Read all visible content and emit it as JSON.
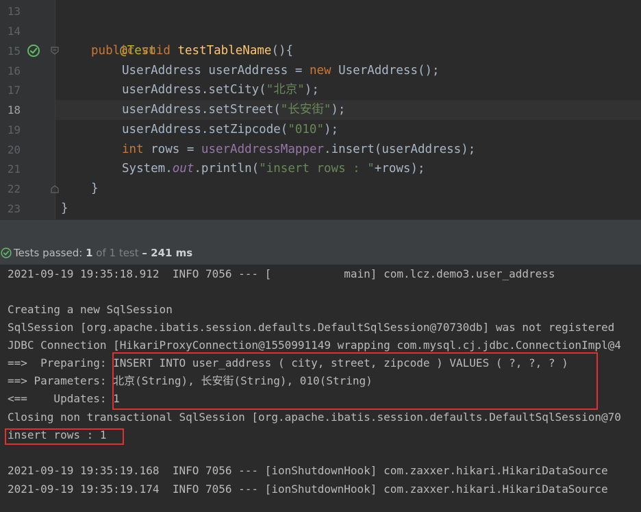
{
  "editor": {
    "line_numbers": [
      "13",
      "14",
      "15",
      "16",
      "17",
      "18",
      "19",
      "20",
      "21",
      "22",
      "23"
    ],
    "active_line": "18",
    "code": {
      "l14": {
        "annotation": "@Test"
      },
      "l15": {
        "kw1": "public",
        "kw2": "void",
        "method": "testTableName",
        "rest": "(){"
      },
      "l16": {
        "p1": "UserAddress userAddress = ",
        "kw": "new",
        "p2": " UserAddress();"
      },
      "l17": {
        "p1": "userAddress.setCity(",
        "str": "\"北京\"",
        "p2": ");"
      },
      "l18": {
        "p1": "userAddress.setStreet(",
        "str": "\"长安街\"",
        "p2": ");"
      },
      "l19": {
        "p1": "userAddress.setZipcode(",
        "str": "\"010\"",
        "p2": ");"
      },
      "l20": {
        "kw": "int",
        "p1": " rows = ",
        "field": "userAddressMapper",
        "p2": ".insert(userAddress);"
      },
      "l21": {
        "p1": "System.",
        "field": "out",
        "p2": ".println(",
        "str": "\"insert rows : \"",
        "p3": "+rows);"
      },
      "l22": {
        "brace": "}"
      },
      "l23": {
        "brace": "}"
      }
    }
  },
  "status": {
    "prefix": "Tests passed:",
    "count": "1",
    "of_text": "of 1 test",
    "time": "– 241 ms"
  },
  "console": {
    "lines": [
      "2021-09-19 19:35:18.912  INFO 7056 --- [           main] com.lcz.demo3.user_address",
      "",
      "Creating a new SqlSession",
      "SqlSession [org.apache.ibatis.session.defaults.DefaultSqlSession@70730db] was not registered",
      "JDBC Connection [HikariProxyConnection@1550991149 wrapping com.mysql.cj.jdbc.ConnectionImpl@4",
      "==>  Preparing: INSERT INTO user_address ( city, street, zipcode ) VALUES ( ?, ?, ? )",
      "==> Parameters: 北京(String), 长安街(String), 010(String)",
      "<==    Updates: 1",
      "Closing non transactional SqlSession [org.apache.ibatis.session.defaults.DefaultSqlSession@70",
      "insert rows : 1",
      "",
      "2021-09-19 19:35:19.168  INFO 7056 --- [ionShutdownHook] com.zaxxer.hikari.HikariDataSource",
      "2021-09-19 19:35:19.174  INFO 7056 --- [ionShutdownHook] com.zaxxer.hikari.HikariDataSource"
    ]
  },
  "colors": {
    "highlight_box": "#e03030",
    "pass_green": "#5fb865",
    "keyword": "#cc7832",
    "method": "#ffc66d",
    "string": "#6a8759"
  }
}
